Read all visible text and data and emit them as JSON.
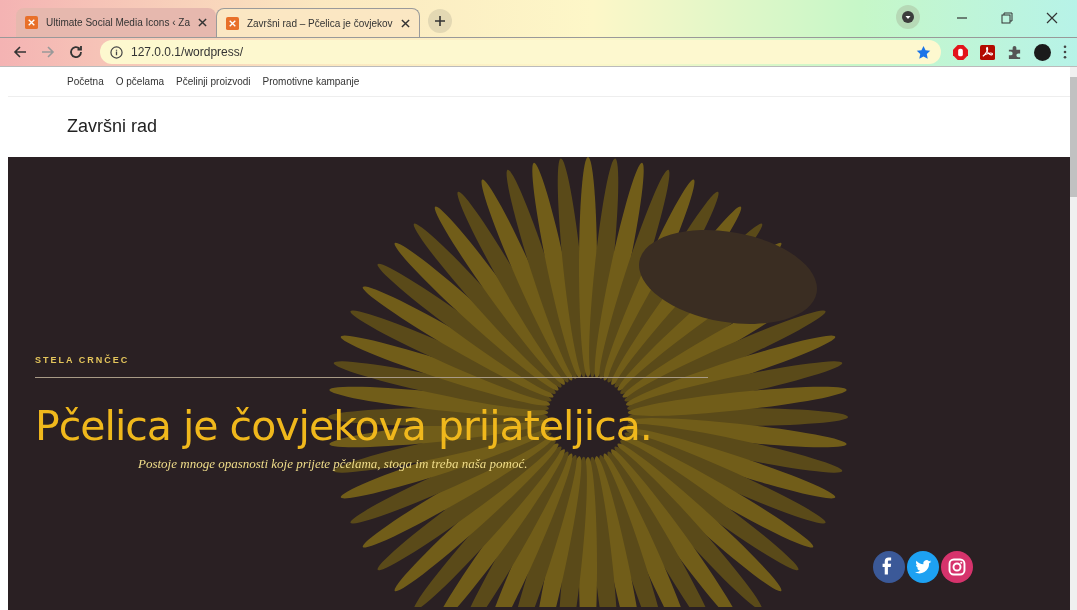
{
  "browser": {
    "tabs": [
      {
        "title": "Ultimate Social Media Icons ‹ Za",
        "selected": false
      },
      {
        "title": "Završni rad – Pčelica je čovjekov",
        "selected": true
      }
    ],
    "address": "127.0.0.1/wordpress/"
  },
  "nav": {
    "items": [
      "Početna",
      "O pčelama",
      "Pčelinji proizvodi",
      "Promotivne kampanje"
    ]
  },
  "site_title": "Završni rad",
  "hero": {
    "eyebrow": "STELA CRNČEC",
    "heading": "Pčelica je čovjekova prijateljica.",
    "subtitle": "Postoje mnoge opasnosti koje prijete pčelama, stoga im treba naša pomoć."
  },
  "social": [
    {
      "kind": "facebook"
    },
    {
      "kind": "twitter"
    },
    {
      "kind": "instagram"
    }
  ]
}
